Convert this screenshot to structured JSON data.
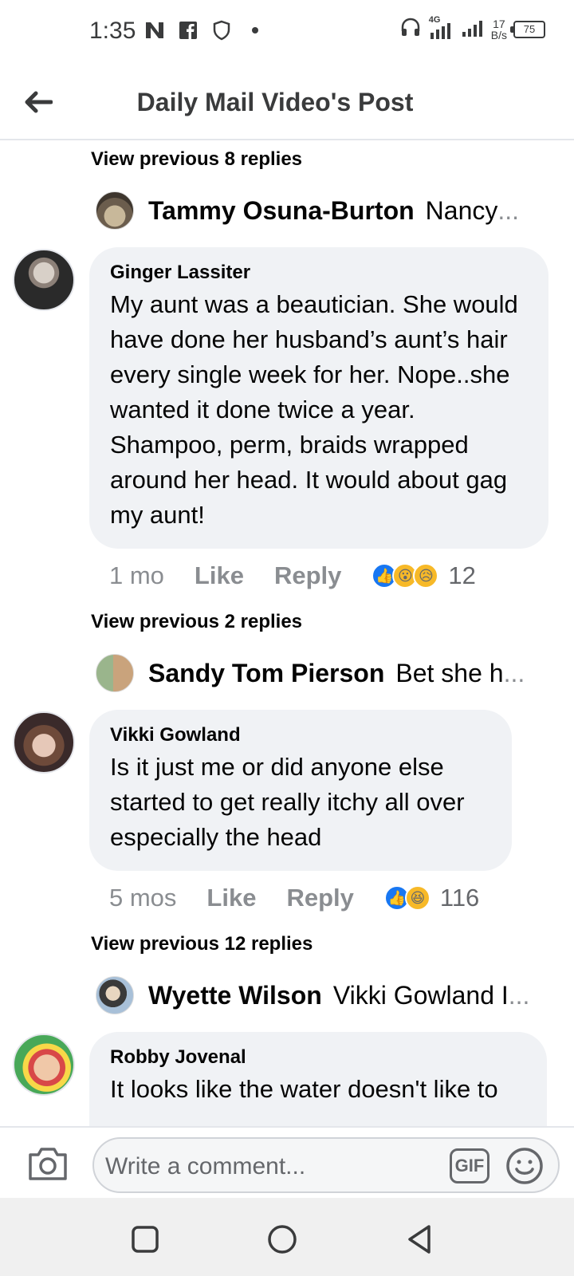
{
  "status_bar": {
    "time": "1:35",
    "network": "4G",
    "speed_value": "17",
    "speed_unit": "B/s",
    "battery": "75"
  },
  "header": {
    "title": "Daily Mail Video's Post"
  },
  "threads": [
    {
      "view_previous": "View previous 8 replies",
      "reply_preview": {
        "name": "Tammy Osuna-Burton",
        "text": "Nancy",
        "ellipsis": "..."
      },
      "comment": {
        "author": "Ginger Lassiter",
        "text": "My aunt was a beautician.  She would have done her husband’s aunt’s hair every single week for her.  Nope..she wanted it done twice a year.  Shampoo, perm, braids wrapped around her head.  It would about gag my aunt!",
        "time": "1 mo",
        "like_label": "Like",
        "reply_label": "Reply",
        "reactions": [
          "like",
          "wow",
          "sad"
        ],
        "reaction_count": "12"
      }
    },
    {
      "view_previous": "View previous 2 replies",
      "reply_preview": {
        "name": "Sandy Tom Pierson",
        "text": "Bet she h",
        "ellipsis": "..."
      },
      "comment": {
        "author": "Vikki Gowland",
        "text": "Is it just me or did anyone else started to get really itchy all over especially the head",
        "time": "5 mos",
        "like_label": "Like",
        "reply_label": "Reply",
        "reactions": [
          "like",
          "haha"
        ],
        "reaction_count": "116"
      }
    },
    {
      "view_previous": "View previous 12 replies",
      "reply_preview": {
        "name": "Wyette Wilson",
        "text": "Vikki Gowland I",
        "ellipsis": "..."
      },
      "comment": {
        "author": "Robby Jovenal",
        "text": "It looks like the water doesn't like to"
      }
    }
  ],
  "composer": {
    "placeholder": "Write a comment...",
    "gif_label": "GIF"
  },
  "colors": {
    "bubble_bg": "#f0f2f5",
    "like_blue": "#1877f2",
    "reaction_yellow": "#f7b928",
    "muted_text": "#65676b"
  }
}
